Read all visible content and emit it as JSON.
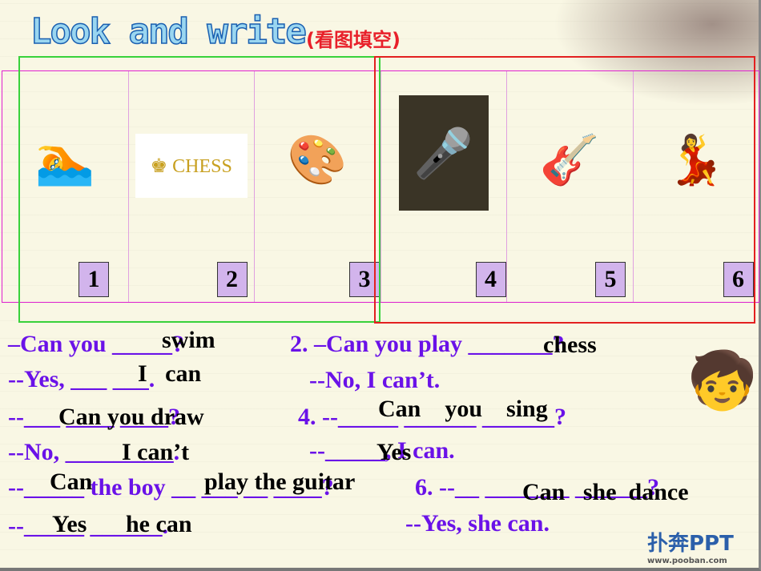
{
  "title": "Look and write",
  "subtitle": "(看图填空)",
  "pictures": [
    {
      "number": "1",
      "icon": "swimmer-icon",
      "glyph": "🏊"
    },
    {
      "number": "2",
      "icon": "chess-icon",
      "glyph": "♚ CHESS"
    },
    {
      "number": "3",
      "icon": "painter-icon",
      "glyph": "🎨"
    },
    {
      "number": "4",
      "icon": "singer-icon",
      "glyph": "🎤"
    },
    {
      "number": "5",
      "icon": "guitarist-icon",
      "glyph": "🎸"
    },
    {
      "number": "6",
      "icon": "dancer-icon",
      "glyph": "💃"
    }
  ],
  "questions": [
    {
      "q": "–Can you _____?",
      "a": "swim"
    },
    {
      "q": "--Yes, ___ ___.",
      "a": "I   can"
    },
    {
      "q": "--___ ____ ____?",
      "a": "Can you draw"
    },
    {
      "q": "--No, _________.",
      "a": "I can’t"
    },
    {
      "q": "--_____ the boy __ ___ __ ____?",
      "a1": "Can",
      "a2": "play the guitar"
    },
    {
      "q": "--_____ ______.",
      "a1": "Yes",
      "a2": "he can"
    },
    {
      "q": "2. –Can you play _______?",
      "a": "chess"
    },
    {
      "q": "--No, I can’t.",
      "a": ""
    },
    {
      "q": "4. --_____ ______ ______?",
      "a": "Can    you    sing"
    },
    {
      "q": "--_____, I can.",
      "a": "Yes"
    },
    {
      "q": "6. --__ _______ ______?",
      "a": "Can   she  dance"
    },
    {
      "q": "--Yes, she can.",
      "a": ""
    }
  ],
  "logo": {
    "text": "扑奔PPT",
    "url": "www.pooban.com"
  },
  "colors": {
    "question": "#6a12e8",
    "answer": "#000000",
    "frame_green": "#39d23b",
    "frame_red": "#e32020",
    "strip": "#e020d0",
    "number_box": "#d2b4ec"
  }
}
